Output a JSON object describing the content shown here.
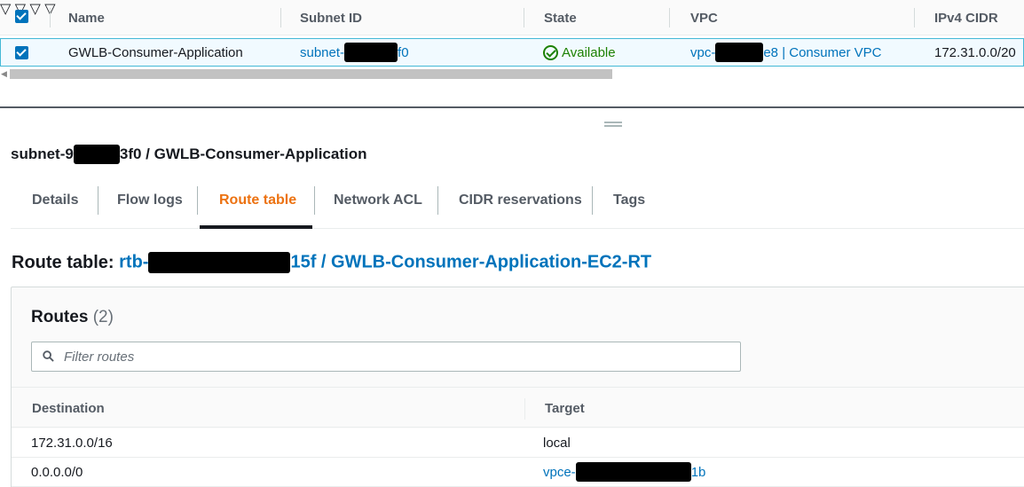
{
  "subnets_table": {
    "columns": [
      "Name",
      "Subnet ID",
      "State",
      "VPC",
      "IPv4 CIDR"
    ],
    "row": {
      "name": "GWLB-Consumer-Application",
      "subnet_id_prefix": "subnet-",
      "subnet_id_suffix": "f0",
      "state": "Available",
      "vpc_prefix": "vpc-",
      "vpc_suffix": "e8 | Consumer VPC",
      "ipv4_cidr": "172.31.0.0/20"
    }
  },
  "detail": {
    "title_prefix": "subnet-",
    "title_mid": "9",
    "title_suffix": "3f0 / GWLB-Consumer-Application",
    "tabs": [
      "Details",
      "Flow logs",
      "Route table",
      "Network ACL",
      "CIDR reservations",
      "Tags"
    ],
    "active_tab": "Route table",
    "route_table": {
      "label": "Route table:",
      "id_prefix": "rtb-",
      "id_suffix": "15f / GWLB-Consumer-Application-EC2-RT"
    },
    "routes": {
      "heading": "Routes",
      "count": "(2)",
      "filter_placeholder": "Filter routes",
      "columns": [
        "Destination",
        "Target"
      ],
      "rows": [
        {
          "destination": "172.31.0.0/16",
          "target": "local",
          "target_suffix": ""
        },
        {
          "destination": "0.0.0.0/0",
          "target": "vpce-",
          "target_suffix": "1b"
        }
      ]
    }
  },
  "colors": {
    "link": "#0073bb",
    "active_tab": "#ec7211",
    "available": "#1d8102",
    "selected_row_bg": "#f1faff"
  }
}
